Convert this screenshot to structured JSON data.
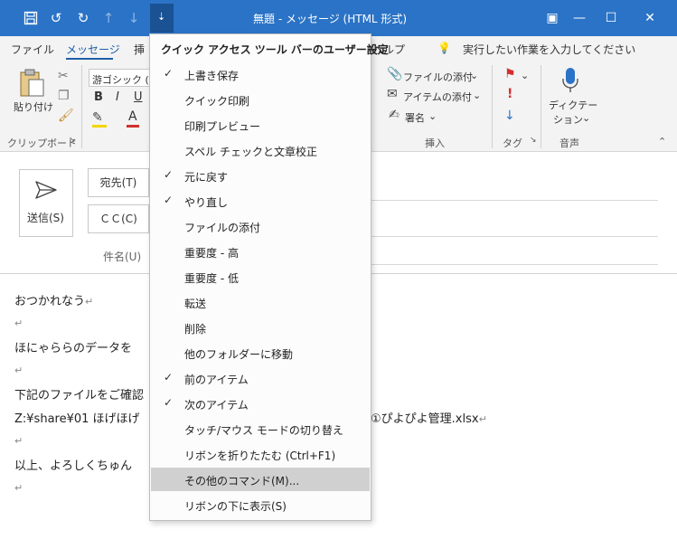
{
  "window": {
    "title": "無題 - メッセージ (HTML 形式)",
    "accent": "#2b73c6"
  },
  "qat": {
    "icons": [
      "save-icon",
      "undo-icon",
      "redo-icon",
      "up-arrow-icon",
      "down-arrow-icon",
      "customize-qat-icon"
    ]
  },
  "ribbon": {
    "tabs": [
      "ファイル",
      "メッセージ",
      "挿",
      "ヘルプ"
    ],
    "tell_me": "実行したい作業を入力してください",
    "paste_label": "貼り付け",
    "clipboard_group": "クリップボード",
    "font_name": "游ゴシック (本",
    "bold": "B",
    "italic": "I",
    "underline": "U",
    "attach_file": "ファイルの添付",
    "attach_item": "アイテムの添付",
    "signature": "署名",
    "insert_group": "挿入",
    "tags_group": "タグ",
    "dictate_label_1": "ディクテー",
    "dictate_label_2": "ション",
    "voice_group": "音声"
  },
  "compose": {
    "send_label": "送信(S)",
    "to_label": "宛先(T)",
    "cc_label": "ＣＣ(C)",
    "subject_label": "件名(U)",
    "body_lines": [
      "おつかれなう",
      "",
      "ほにゃららのデータを",
      "",
      "下記のファイルをご確認",
      "Z:¥share¥01 ほげほげ",
      "",
      "以上、よろしくちゅん",
      ""
    ],
    "body_line_tail": "①ぴよぴよ管理.xlsx",
    "paragraph_mark": "↵"
  },
  "menu": {
    "header": "クイック アクセス ツール バーのユーザー設定",
    "items": [
      {
        "label": "上書き保存",
        "checked": true
      },
      {
        "label": "クイック印刷",
        "checked": false
      },
      {
        "label": "印刷プレビュー",
        "checked": false
      },
      {
        "label": "スペル チェックと文章校正",
        "checked": false
      },
      {
        "label": "元に戻す",
        "checked": true
      },
      {
        "label": "やり直し",
        "checked": true
      },
      {
        "label": "ファイルの添付",
        "checked": false
      },
      {
        "label": "重要度 - 高",
        "checked": false
      },
      {
        "label": "重要度 - 低",
        "checked": false
      },
      {
        "label": "転送",
        "checked": false
      },
      {
        "label": "削除",
        "checked": false
      },
      {
        "label": "他のフォルダーに移動",
        "checked": false
      },
      {
        "label": "前のアイテム",
        "checked": true
      },
      {
        "label": "次のアイテム",
        "checked": true
      },
      {
        "label": "タッチ/マウス モードの切り替え",
        "checked": false
      },
      {
        "label": "リボンを折りたたむ (Ctrl+F1)",
        "checked": false
      },
      {
        "label": "その他のコマンド(M)...",
        "checked": false,
        "highlighted": true
      },
      {
        "label": "リボンの下に表示(S)",
        "checked": false
      }
    ],
    "check_glyph": "✓"
  }
}
